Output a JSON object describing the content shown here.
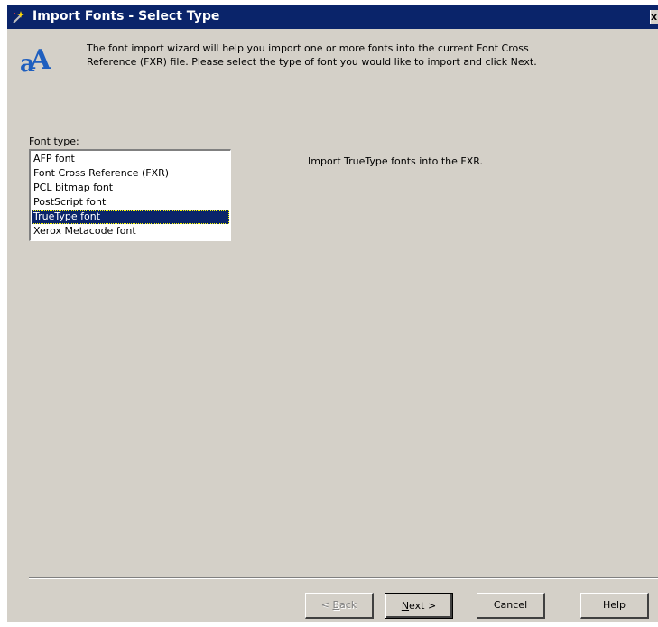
{
  "window": {
    "title": "Import Fonts - Select Type",
    "close_glyph": "x"
  },
  "header": {
    "icon": "font-a-icon",
    "intro_line1": "The font import wizard will help you import one or more fonts into the current Font Cross",
    "intro_line2": "Reference (FXR) file. Please select the type of font you would like to import and click Next."
  },
  "font_type": {
    "label": "Font type:",
    "items": [
      {
        "label": "AFP font",
        "selected": false
      },
      {
        "label": "Font Cross Reference (FXR)",
        "selected": false
      },
      {
        "label": "PCL bitmap font",
        "selected": false
      },
      {
        "label": "PostScript font",
        "selected": false
      },
      {
        "label": "TrueType font",
        "selected": true
      },
      {
        "label": "Xerox Metacode font",
        "selected": false
      }
    ],
    "description": "Import TrueType fonts into the FXR."
  },
  "buttons": {
    "back_prefix": "< ",
    "back_mnemonic": "B",
    "back_rest": "ack",
    "next_mnemonic": "N",
    "next_rest": "ext >",
    "cancel": "Cancel",
    "help": "Help"
  },
  "colors": {
    "titlebar": "#0a246a",
    "dialog_bg": "#d4d0c8",
    "selection": "#0a246a",
    "icon_blue": "#1f5fbf"
  }
}
